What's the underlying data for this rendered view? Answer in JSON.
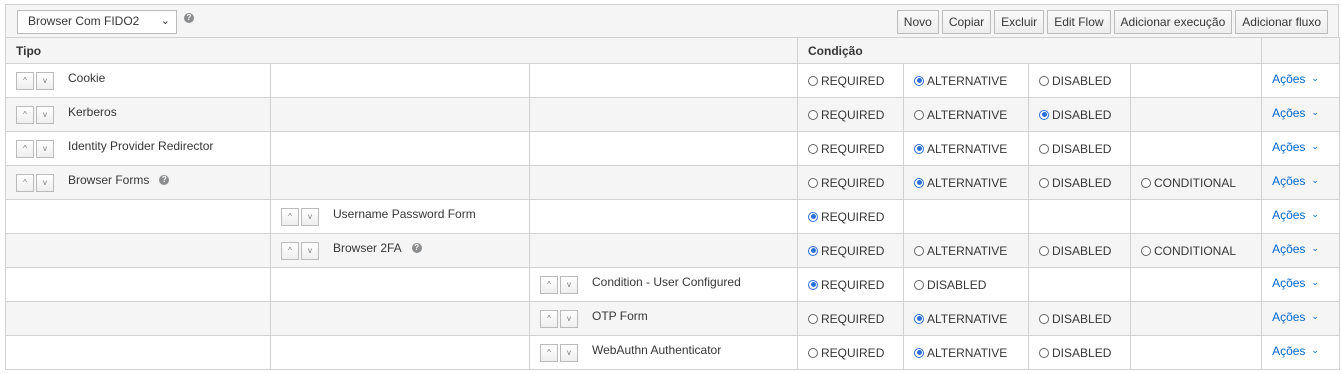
{
  "flow_select": {
    "value": "Browser Com FIDO2"
  },
  "help_symbol": "?",
  "toolbar": [
    "Novo",
    "Copiar",
    "Excluir",
    "Edit Flow",
    "Adicionar execução",
    "Adicionar fluxo"
  ],
  "headers": {
    "tipo": "Tipo",
    "condicao": "Condição"
  },
  "acoes_label": "Ações",
  "arrows": {
    "up": "^",
    "down": "v"
  },
  "rows": [
    {
      "level": 0,
      "name": "Cookie",
      "help": false,
      "options": [
        "REQUIRED",
        "ALTERNATIVE",
        "DISABLED"
      ],
      "selected": "ALTERNATIVE"
    },
    {
      "level": 0,
      "name": "Kerberos",
      "help": false,
      "options": [
        "REQUIRED",
        "ALTERNATIVE",
        "DISABLED"
      ],
      "selected": "DISABLED"
    },
    {
      "level": 0,
      "name": "Identity Provider Redirector",
      "help": false,
      "options": [
        "REQUIRED",
        "ALTERNATIVE",
        "DISABLED"
      ],
      "selected": "ALTERNATIVE"
    },
    {
      "level": 0,
      "name": "Browser Forms",
      "help": true,
      "options": [
        "REQUIRED",
        "ALTERNATIVE",
        "DISABLED",
        "CONDITIONAL"
      ],
      "selected": "ALTERNATIVE"
    },
    {
      "level": 1,
      "name": "Username Password Form",
      "help": false,
      "options": [
        "REQUIRED"
      ],
      "selected": "REQUIRED"
    },
    {
      "level": 1,
      "name": "Browser 2FA",
      "help": true,
      "options": [
        "REQUIRED",
        "ALTERNATIVE",
        "DISABLED",
        "CONDITIONAL"
      ],
      "selected": "REQUIRED"
    },
    {
      "level": 2,
      "name": "Condition - User Configured",
      "help": false,
      "options": [
        "REQUIRED",
        "DISABLED"
      ],
      "selected": "REQUIRED"
    },
    {
      "level": 2,
      "name": "OTP Form",
      "help": false,
      "options": [
        "REQUIRED",
        "ALTERNATIVE",
        "DISABLED"
      ],
      "selected": "ALTERNATIVE"
    },
    {
      "level": 2,
      "name": "WebAuthn Authenticator",
      "help": false,
      "options": [
        "REQUIRED",
        "ALTERNATIVE",
        "DISABLED"
      ],
      "selected": "ALTERNATIVE"
    }
  ]
}
